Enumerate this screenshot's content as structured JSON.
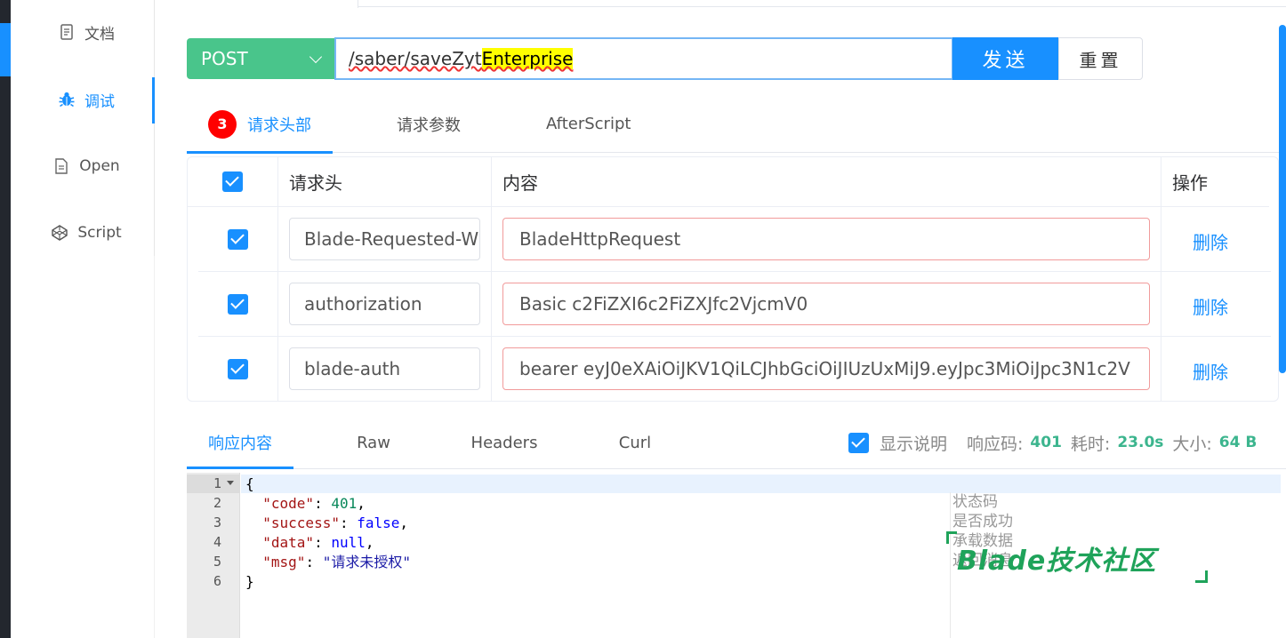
{
  "sidebar": {
    "items": [
      {
        "label": "文档",
        "icon": "document-icon"
      },
      {
        "label": "调试",
        "icon": "bug-icon",
        "active": true
      },
      {
        "label": "Open",
        "icon": "file-icon"
      },
      {
        "label": "Script",
        "icon": "codepen-icon"
      }
    ]
  },
  "request": {
    "method": "POST",
    "url_prefix": "/saber/saveZyt",
    "url_highlight": "Enterprise",
    "send_label": "发送",
    "reset_label": "重置"
  },
  "req_tabs": {
    "headers": {
      "label": "请求头部",
      "badge": "3"
    },
    "params": {
      "label": "请求参数"
    },
    "after": {
      "label": "AfterScript"
    }
  },
  "headers_table": {
    "col_key": "请求头",
    "col_value": "内容",
    "col_action": "操作",
    "rows": [
      {
        "key": "Blade-Requested-With",
        "value": "BladeHttpRequest",
        "action": "删除"
      },
      {
        "key": "authorization",
        "value": "Basic c2FiZXI6c2FiZXJfc2VjcmV0",
        "action": "删除"
      },
      {
        "key": "blade-auth",
        "value": "bearer eyJ0eXAiOiJKV1QiLCJhbGciOiJIUzUxMiJ9.eyJpc3MiOiJpc3N1c2V",
        "action": "删除"
      }
    ]
  },
  "resp_tabs": {
    "content": "响应内容",
    "raw": "Raw",
    "headers": "Headers",
    "curl": "Curl"
  },
  "resp_meta": {
    "show_desc": "显示说明",
    "code_label": "响应码:",
    "code_value": "401",
    "time_label": "耗时:",
    "time_value": "23.0s",
    "size_label": "大小:",
    "size_value": "64 B"
  },
  "response_json": {
    "lines": [
      "1",
      "2",
      "3",
      "4",
      "5",
      "6"
    ],
    "code_key": "\"code\"",
    "code_val": "401",
    "success_key": "\"success\"",
    "success_val": "false",
    "data_key": "\"data\"",
    "data_val": "null",
    "msg_key": "\"msg\"",
    "msg_val": "\"请求未授权\""
  },
  "response_comments": [
    "状态码",
    "是否成功",
    "承载数据",
    "返回消息"
  ],
  "watermark": "Blade技术社区",
  "colors": {
    "accent": "#1890ff",
    "method": "#49c58b",
    "success_text": "#3cb58e",
    "watermark": "#1fa35a"
  }
}
